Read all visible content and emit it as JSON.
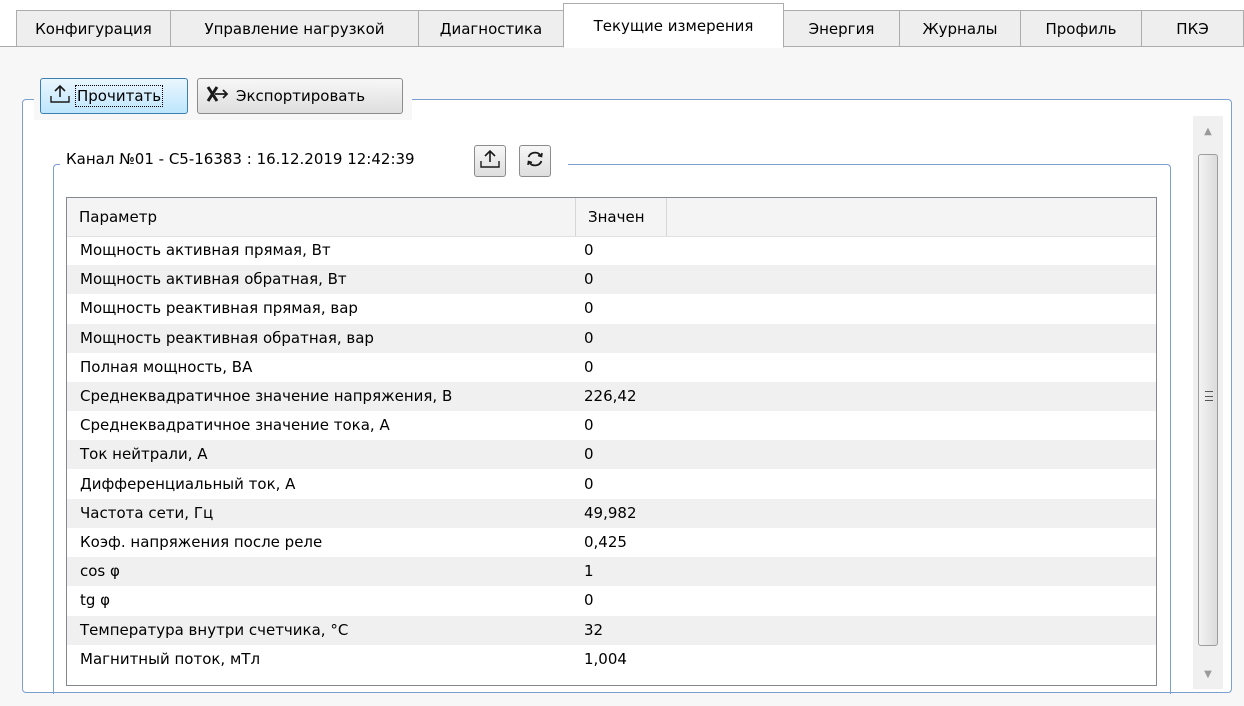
{
  "tabs": [
    {
      "label": "Конфигурация",
      "active": false
    },
    {
      "label": "Управление нагрузкой",
      "active": false
    },
    {
      "label": "Диагностика",
      "active": false
    },
    {
      "label": "Текущие измерения",
      "active": true
    },
    {
      "label": "Энергия",
      "active": false
    },
    {
      "label": "Журналы",
      "active": false
    },
    {
      "label": "Профиль",
      "active": false
    },
    {
      "label": "ПКЭ",
      "active": false
    }
  ],
  "toolbar": {
    "read_label": "Прочитать",
    "read_icon": "upload-icon",
    "export_label": "Экспортировать",
    "export_icon": "export-icon"
  },
  "channel": {
    "title": "Канал №01 - С5-16383 : 16.12.2019 12:42:39",
    "read_icon": "upload-icon",
    "refresh_icon": "refresh-icon"
  },
  "table": {
    "columns": [
      "Параметр",
      "Значен"
    ],
    "rows": [
      [
        "Мощность активная прямая, Вт",
        "0"
      ],
      [
        "Мощность активная обратная, Вт",
        "0"
      ],
      [
        "Мощность реактивная прямая, вар",
        "0"
      ],
      [
        "Мощность реактивная обратная, вар",
        "0"
      ],
      [
        "Полная мощность, ВА",
        "0"
      ],
      [
        "Среднеквадратичное значение напряжения, В",
        "226,42"
      ],
      [
        "Среднеквадратичное значение тока, А",
        "0"
      ],
      [
        "Ток нейтрали, А",
        "0"
      ],
      [
        "Дифференциальный ток, А",
        "0"
      ],
      [
        "Частота сети, Гц",
        "49,982"
      ],
      [
        "Коэф. напряжения после реле",
        "0,425"
      ],
      [
        "cos φ",
        "1"
      ],
      [
        "tg φ",
        "0"
      ],
      [
        "Температура внутри счетчика, °С",
        "32"
      ],
      [
        "Магнитный поток, мТл",
        "1,004"
      ]
    ]
  },
  "colors": {
    "group_border": "#7b9ed3",
    "button_focus": "#bee6fd",
    "row_alt": "#f0f0f0"
  }
}
